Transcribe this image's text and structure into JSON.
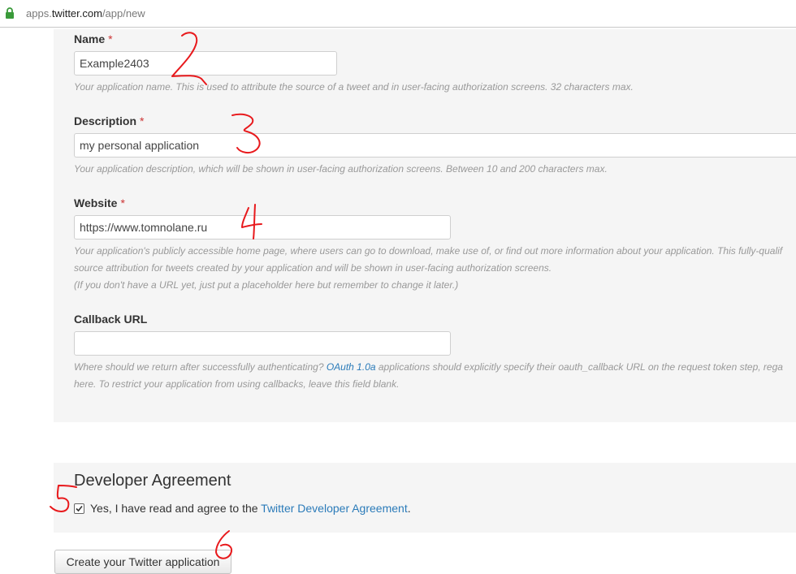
{
  "browser": {
    "url_prefix": "apps.",
    "url_host": "twitter.com",
    "url_path": "/app/new"
  },
  "form": {
    "required_marker": "*",
    "name": {
      "label": "Name",
      "value": "Example2403",
      "help": "Your application name. This is used to attribute the source of a tweet and in user-facing authorization screens. 32 characters max."
    },
    "description": {
      "label": "Description",
      "value": "my personal application",
      "help": "Your application description, which will be shown in user-facing authorization screens. Between 10 and 200 characters max."
    },
    "website": {
      "label": "Website",
      "value": "https://www.tomnolane.ru",
      "help_line1": "Your application's publicly accessible home page, where users can go to download, make use of, or find out more information about your application. This fully-qualif",
      "help_line2": "source attribution for tweets created by your application and will be shown in user-facing authorization screens.",
      "help_line3": "(If you don't have a URL yet, just put a placeholder here but remember to change it later.)"
    },
    "callback": {
      "label": "Callback URL",
      "value": "",
      "help_line1_pre": "Where should we return after successfully authenticating? ",
      "help_line1_link": "OAuth 1.0a",
      "help_line1_post": " applications should explicitly specify their oauth_callback URL on the request token step, rega",
      "help_line2": "here. To restrict your application from using callbacks, leave this field blank."
    }
  },
  "agreement": {
    "title": "Developer Agreement",
    "checked": true,
    "text_pre": "Yes, I have read and agree to the ",
    "link": "Twitter Developer Agreement",
    "text_post": "."
  },
  "submit_label": "Create your Twitter application",
  "annotations": [
    "2",
    "3",
    "4",
    "5",
    "6"
  ],
  "colors": {
    "link": "#2b7bb9",
    "required": "#cc3333",
    "annotation": "#e8191c",
    "panel": "#f5f5f5"
  }
}
